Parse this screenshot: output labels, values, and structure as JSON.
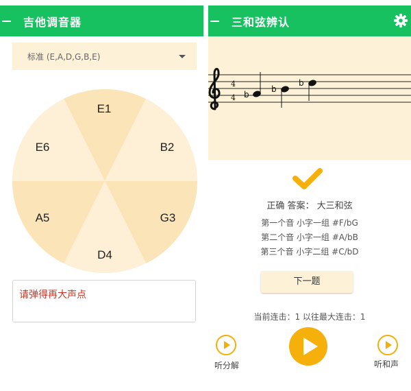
{
  "left": {
    "appbar": {
      "title": "吉他调音器"
    },
    "tuning_select": {
      "selected": "标准 (E,A,D,G,B,E)"
    },
    "strings": [
      "E1",
      "B2",
      "G3",
      "D4",
      "A5",
      "E6"
    ],
    "hint": "请弹得再大声点",
    "colors": {
      "appbar": "#17c160",
      "accent": "#fdf2d7",
      "hint_text": "#c0392b"
    }
  },
  "right": {
    "appbar": {
      "title": "三和弦辨认"
    },
    "staff": {
      "time_signature_top": "4",
      "time_signature_bottom": "4",
      "flat_symbol": "b"
    },
    "result": {
      "answer_line": "正确 答案： 大三和弦",
      "notes": [
        "第一个音 小字一组 #F/bG",
        "第二个音 小字一组 #A/bB",
        "第三个音 小字二组 #C/bD"
      ]
    },
    "next_button": "下一题",
    "streak": "当前连击：1 以往最大连击：1",
    "listen_arpeggio": "听分解",
    "listen_chord": "听和声",
    "colors": {
      "play": "#f5b00b"
    }
  }
}
